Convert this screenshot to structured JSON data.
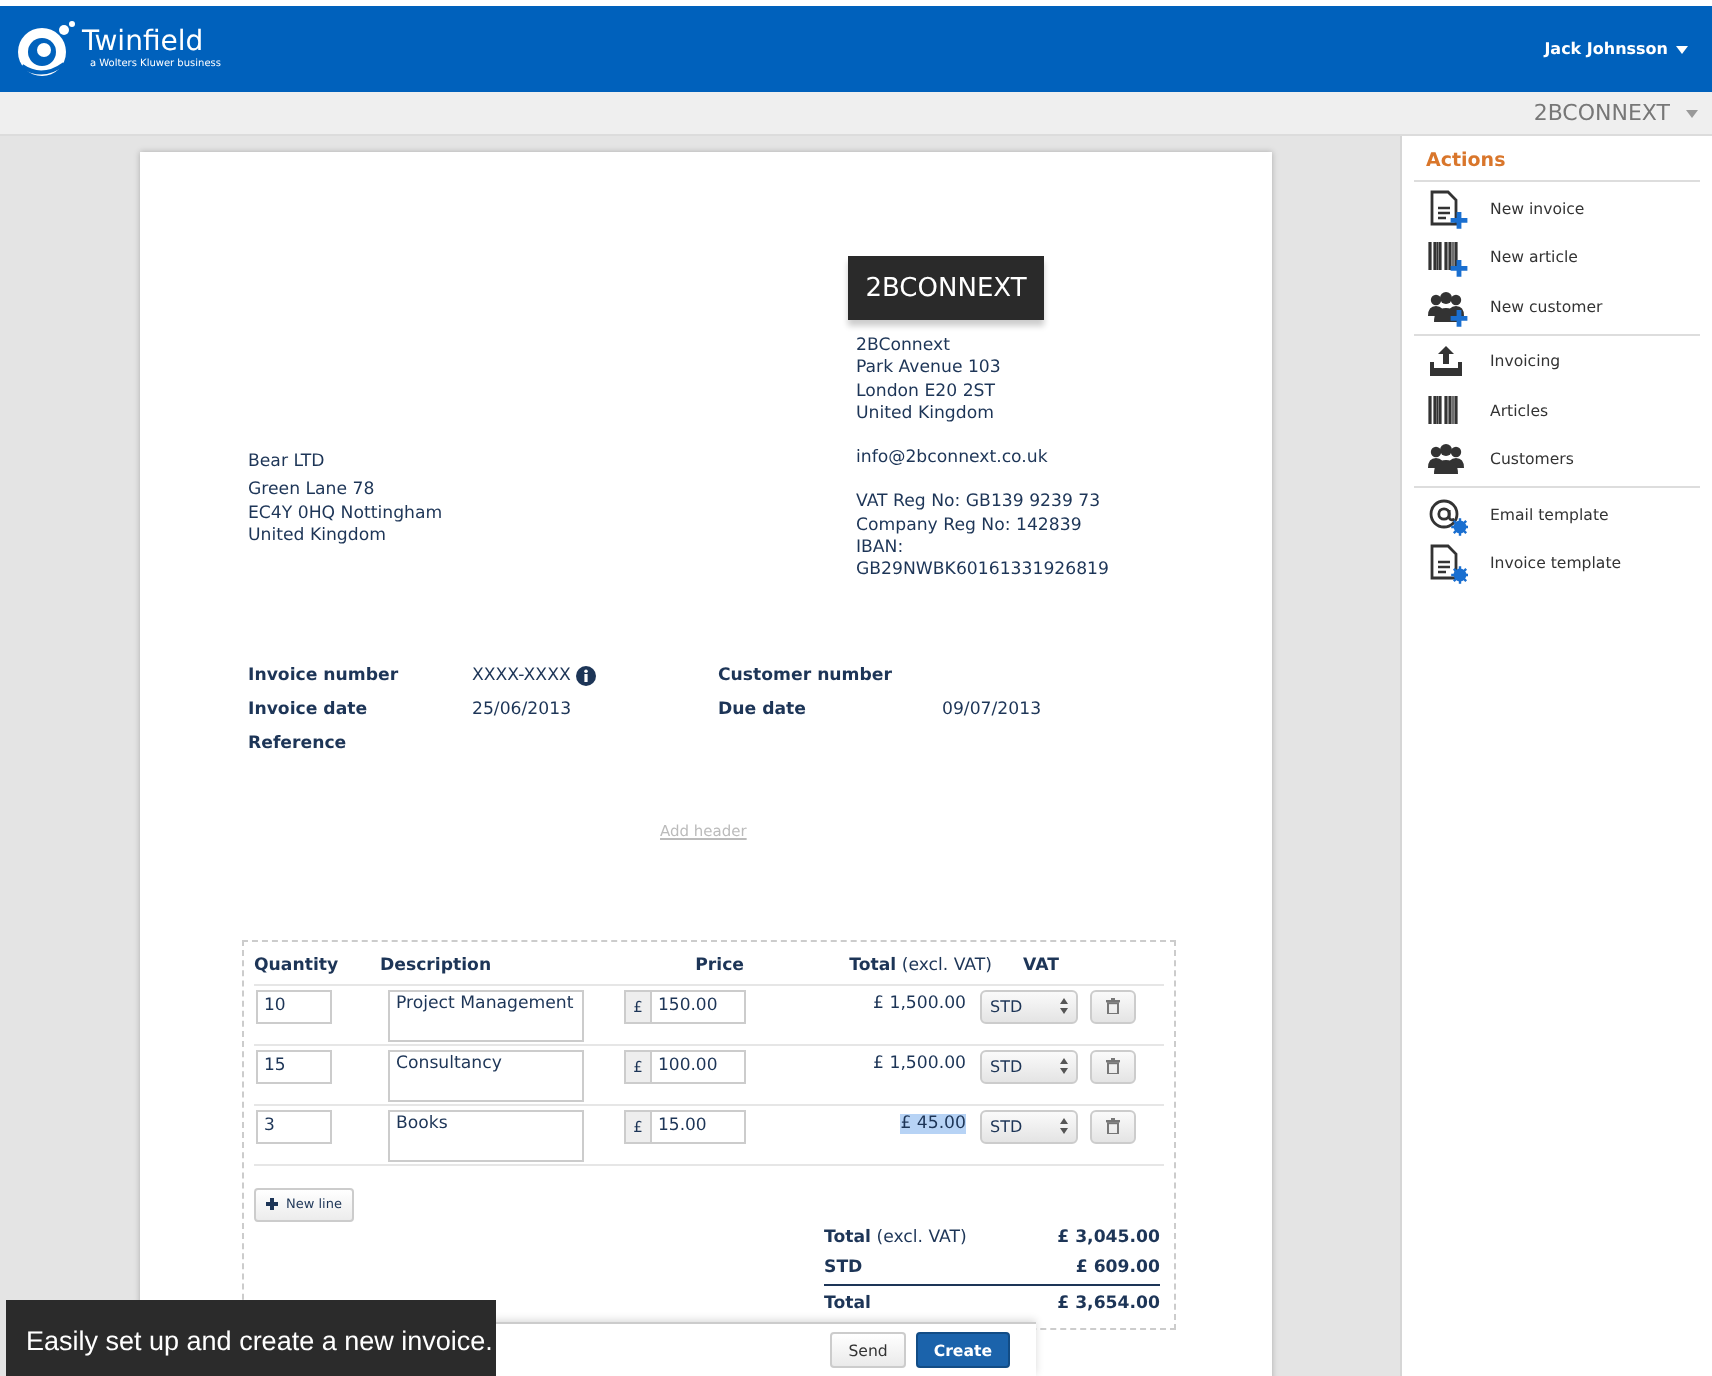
{
  "header": {
    "brand": "Twinfield",
    "tagline": "a Wolters Kluwer business",
    "user": "Jack Johnsson"
  },
  "company_bar": {
    "company": "2BCONNEXT"
  },
  "invoice": {
    "logo_text": "2BCONNEXT",
    "sender": [
      "2BConnext",
      "Park Avenue 103",
      "London E20 2ST",
      "United Kingdom"
    ],
    "email": "info@2bconnext.co.uk",
    "registration": [
      "VAT Reg No: GB139 9239 73",
      "Company Reg No: 142839",
      "IBAN:",
      "GB29NWBK60161331926819"
    ],
    "customer": {
      "name": "Bear LTD",
      "address": [
        "Green Lane 78",
        "EC4Y 0HQ Nottingham",
        "United Kingdom"
      ]
    },
    "meta_rows": [
      [
        {
          "label": "Invoice number",
          "value": "XXXX-XXXX",
          "info": true
        },
        {
          "label": "Customer number"
        }
      ],
      [
        {
          "label": "Invoice date",
          "value": "25/06/2013"
        },
        {
          "label": "Due date",
          "value": "09/07/2013"
        }
      ],
      [
        {
          "label": "Reference"
        }
      ]
    ],
    "add_header": "Add header",
    "columns": [
      "Quantity",
      "Description",
      "Price",
      "**Total** (excl. VAT)",
      "VAT"
    ],
    "rows": [
      {
        "quantity": "10",
        "description": "Project Management",
        "currency": "£",
        "price": "150.00",
        "total": "£ 1,500.00",
        "total_selected": false,
        "vat": "STD"
      },
      {
        "quantity": "15",
        "description": "Consultancy",
        "currency": "£",
        "price": "100.00",
        "total": "£ 1,500.00",
        "total_selected": false,
        "vat": "STD"
      },
      {
        "quantity": "3",
        "description": "Books",
        "currency": "£",
        "price": "15.00",
        "total": "£ 45.00",
        "total_selected": true,
        "vat": "STD"
      }
    ],
    "new_line": "New line",
    "totals": [
      {
        "label": "**Total** (excl. VAT)",
        "value": "£ 3,045.00",
        "kind": "subtotal"
      },
      {
        "label": "STD",
        "value": "£ 609.00",
        "kind": "tax"
      },
      {
        "label": "Total",
        "value": "£ 3,654.00",
        "kind": "grand"
      }
    ]
  },
  "actions": {
    "title": "Actions",
    "groups": [
      [
        {
          "label": "New invoice",
          "kind": "document_add"
        },
        {
          "label": "New article",
          "kind": "barcode_add"
        },
        {
          "label": "New customer",
          "kind": "people_add"
        }
      ],
      [
        {
          "label": "Invoicing",
          "kind": "inbox"
        },
        {
          "label": "Articles",
          "kind": "barcode"
        },
        {
          "label": "Customers",
          "kind": "people"
        }
      ],
      [
        {
          "label": "Email template",
          "kind": "at_settings"
        },
        {
          "label": "Invoice template",
          "kind": "document_settings"
        }
      ]
    ]
  },
  "action_bar": {
    "buttons": [
      {
        "label": "Send",
        "kind": "secondary"
      },
      {
        "label": "Create",
        "kind": "primary"
      }
    ]
  },
  "caption": "Easily set up and create a new invoice."
}
